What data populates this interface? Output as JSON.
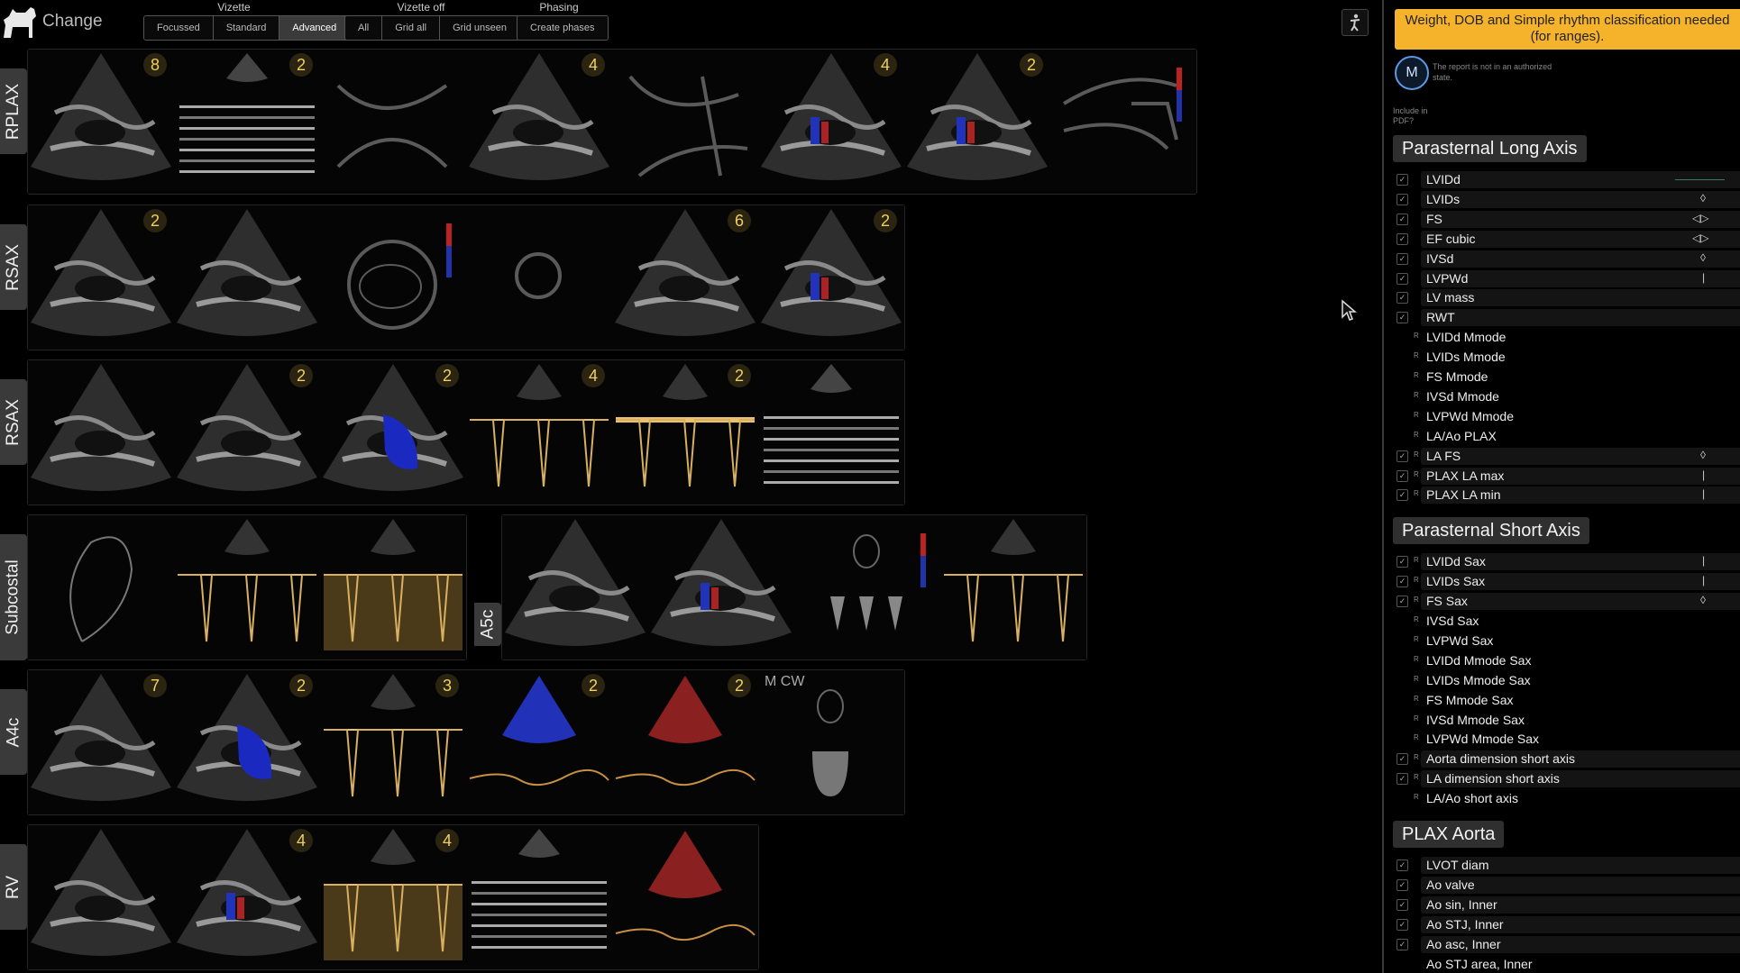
{
  "topbar": {
    "change_label": "Change",
    "vizette_label": "Vizette",
    "vizette_options": [
      "Focussed",
      "Standard",
      "Advanced"
    ],
    "vizette_selected": "Advanced",
    "vizette_off_label": "Vizette off",
    "vizette_off_options": [
      "All",
      "Grid all",
      "Grid unseen"
    ],
    "phasing_label": "Phasing",
    "phasing_options": [
      "Create phases"
    ]
  },
  "rows": [
    {
      "label": "RPLAX",
      "tiles": [
        {
          "kind": "echo",
          "badge": "8"
        },
        {
          "kind": "mmode",
          "badge": "2"
        },
        {
          "kind": "diagram-plax"
        },
        {
          "kind": "echo",
          "badge": "4"
        },
        {
          "kind": "diagram-plax2"
        },
        {
          "kind": "echo-color",
          "badge": "4"
        },
        {
          "kind": "echo-color",
          "badge": "2"
        },
        {
          "kind": "diagram-plax3"
        }
      ]
    },
    {
      "label": "RSAX",
      "tiles": [
        {
          "kind": "echo",
          "badge": "2"
        },
        {
          "kind": "echo"
        },
        {
          "kind": "diagram-sax"
        },
        {
          "kind": "diagram-ring"
        },
        {
          "kind": "echo",
          "badge": "6"
        },
        {
          "kind": "echo-color",
          "badge": "2"
        }
      ]
    },
    {
      "label": "RSAX",
      "tiles": [
        {
          "kind": "echo"
        },
        {
          "kind": "echo",
          "badge": "2"
        },
        {
          "kind": "echo-blue",
          "badge": "2"
        },
        {
          "kind": "doppler",
          "badge": "4"
        },
        {
          "kind": "doppler-bright",
          "badge": "2"
        },
        {
          "kind": "mmode"
        }
      ]
    },
    {
      "label": "Subcostal",
      "tiles": [
        {
          "kind": "diagram-sub"
        },
        {
          "kind": "doppler"
        },
        {
          "kind": "doppler-fill"
        }
      ]
    },
    {
      "label": "A5c",
      "tiles": [
        {
          "kind": "echo"
        },
        {
          "kind": "echo-color"
        },
        {
          "kind": "diagram-a5c"
        },
        {
          "kind": "doppler"
        }
      ]
    },
    {
      "label": "A4c",
      "tiles": [
        {
          "kind": "echo",
          "badge": "7"
        },
        {
          "kind": "echo-blue",
          "badge": "2"
        },
        {
          "kind": "doppler",
          "badge": "3"
        },
        {
          "kind": "color-doppler",
          "badge": "2"
        },
        {
          "kind": "color-doppler-red",
          "badge": "2"
        },
        {
          "kind": "diagram-mcw",
          "label": "M CW"
        }
      ]
    },
    {
      "label": "RV",
      "tiles": [
        {
          "kind": "echo"
        },
        {
          "kind": "echo-color",
          "badge": "4"
        },
        {
          "kind": "doppler-fill",
          "badge": "4"
        },
        {
          "kind": "mmode"
        },
        {
          "kind": "color-doppler-red"
        }
      ]
    }
  ],
  "report": {
    "warning": "Weight, DOB and Simple rhythm classification needed (for ranges).",
    "avatar_letter": "M",
    "auth_note": "The report is not in an authorized state.",
    "include_label": "Include in PDF?",
    "sections": [
      {
        "title": "Parasternal Long Axis",
        "rows": [
          {
            "name": "LVIDd",
            "checked": true,
            "indicator": "line"
          },
          {
            "name": "LVIDs",
            "checked": true,
            "indicator": "diamond"
          },
          {
            "name": "FS",
            "checked": true,
            "indicator": "lr"
          },
          {
            "name": "EF cubic",
            "checked": true,
            "indicator": "lr"
          },
          {
            "name": "IVSd",
            "checked": true,
            "indicator": "diamond"
          },
          {
            "name": "LVPWd",
            "checked": true,
            "indicator": "tick"
          },
          {
            "name": "LV mass",
            "checked": true
          },
          {
            "name": "RWT",
            "checked": true
          },
          {
            "name": "LVIDd Mmode",
            "r": true
          },
          {
            "name": "LVIDs Mmode",
            "r": true
          },
          {
            "name": "FS Mmode",
            "r": true
          },
          {
            "name": "IVSd Mmode",
            "r": true
          },
          {
            "name": "LVPWd Mmode",
            "r": true
          },
          {
            "name": "LA/Ao PLAX",
            "r": true
          },
          {
            "name": "LA FS",
            "checked": true,
            "r": true,
            "indicator": "diamond"
          },
          {
            "name": "PLAX LA max",
            "checked": true,
            "r": true,
            "indicator": "tick"
          },
          {
            "name": "PLAX LA min",
            "checked": true,
            "r": true,
            "indicator": "tick"
          }
        ]
      },
      {
        "title": "Parasternal Short Axis",
        "rows": [
          {
            "name": "LVIDd Sax",
            "checked": true,
            "r": true,
            "indicator": "tick"
          },
          {
            "name": "LVIDs Sax",
            "checked": true,
            "r": true,
            "indicator": "tick"
          },
          {
            "name": "FS Sax",
            "checked": true,
            "r": true,
            "indicator": "diamond"
          },
          {
            "name": "IVSd Sax",
            "r": true
          },
          {
            "name": "LVPWd Sax",
            "r": true
          },
          {
            "name": "LVIDd Mmode Sax",
            "r": true
          },
          {
            "name": "LVIDs Mmode Sax",
            "r": true
          },
          {
            "name": "FS Mmode Sax",
            "r": true
          },
          {
            "name": "IVSd Mmode Sax",
            "r": true
          },
          {
            "name": "LVPWd Mmode Sax",
            "r": true
          },
          {
            "name": "Aorta dimension short axis",
            "checked": true,
            "r": true
          },
          {
            "name": "LA dimension short axis",
            "checked": true,
            "r": true
          },
          {
            "name": "LA/Ao short axis",
            "r": true
          }
        ]
      },
      {
        "title": "PLAX Aorta",
        "rows": [
          {
            "name": "LVOT diam",
            "checked": true
          },
          {
            "name": "Ao valve",
            "checked": true
          },
          {
            "name": "Ao sin, Inner",
            "checked": true
          },
          {
            "name": "Ao STJ, Inner",
            "checked": true
          },
          {
            "name": "Ao asc, Inner",
            "checked": true
          },
          {
            "name": "Ao STJ area, Inner"
          }
        ]
      }
    ]
  }
}
